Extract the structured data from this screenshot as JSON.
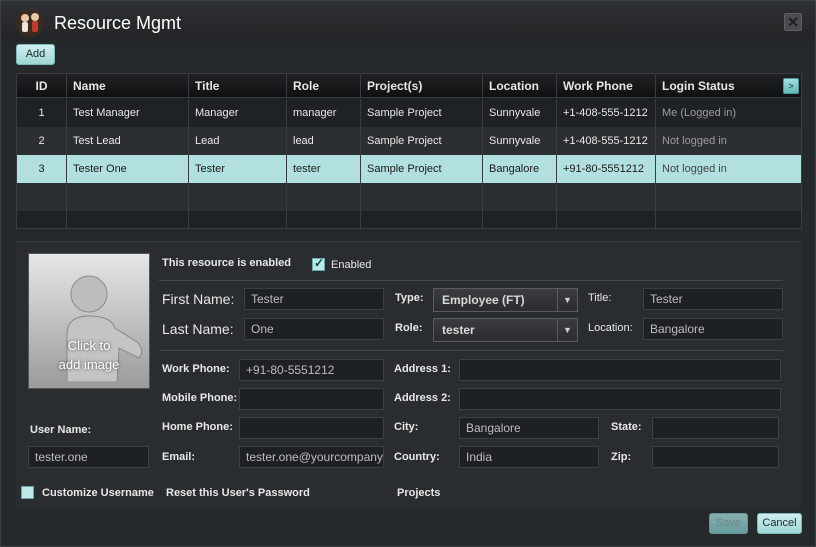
{
  "window": {
    "title": "Resource Mgmt",
    "close_glyph": "✕"
  },
  "toolbar": {
    "add_label": "Add"
  },
  "grid": {
    "columns": [
      "ID",
      "Name",
      "Title",
      "Role",
      "Project(s)",
      "Location",
      "Work Phone",
      "Login Status"
    ],
    "more_glyph": ">",
    "rows": [
      [
        "1",
        "Test Manager",
        "Manager",
        "manager",
        "Sample Project",
        "Sunnyvale",
        "+1-408-555-1212",
        "Me (Logged in)"
      ],
      [
        "2",
        "Test Lead",
        "Lead",
        "lead",
        "Sample Project",
        "Sunnyvale",
        "+1-408-555-1212",
        "Not logged in"
      ],
      [
        "3",
        "Tester One",
        "Tester",
        "tester",
        "Sample Project",
        "Bangalore",
        "+91-80-5551212",
        "Not logged in"
      ]
    ],
    "selected_row": 2
  },
  "detail": {
    "photo_text_line1": "Click to",
    "photo_text_line2": "add image",
    "enabled_text": "This resource is enabled",
    "enabled_label": "Enabled",
    "enabled_checked": true,
    "first_name_label": "First Name:",
    "first_name": "Tester",
    "last_name_label": "Last Name:",
    "last_name": "One",
    "type_label": "Type:",
    "type_value": "Employee (FT)",
    "role_label": "Role:",
    "role_value": "tester",
    "title_label": "Title:",
    "title_value": "Tester",
    "location_label": "Location:",
    "location_value": "Bangalore",
    "work_phone_label": "Work Phone:",
    "work_phone": "+91-80-5551212",
    "mobile_phone_label": "Mobile Phone:",
    "mobile_phone": "",
    "home_phone_label": "Home Phone:",
    "home_phone": "",
    "email_label": "Email:",
    "email": "tester.one@yourcompany",
    "address1_label": "Address 1:",
    "address1": "",
    "address2_label": "Address 2:",
    "address2": "",
    "city_label": "City:",
    "city": "Bangalore",
    "state_label": "State:",
    "state": "",
    "country_label": "Country:",
    "country": "India",
    "zip_label": "Zip:",
    "zip": "",
    "username_label": "User Name:",
    "username": "tester.one",
    "customize_username_label": "Customize Username",
    "reset_password_label": "Reset this User's Password",
    "projects_label": "Projects"
  },
  "footer": {
    "save_label": "Save",
    "cancel_label": "Cancel"
  },
  "colors": {
    "selected_row": "#b2e0e0",
    "accent": "#9fd6d6"
  }
}
